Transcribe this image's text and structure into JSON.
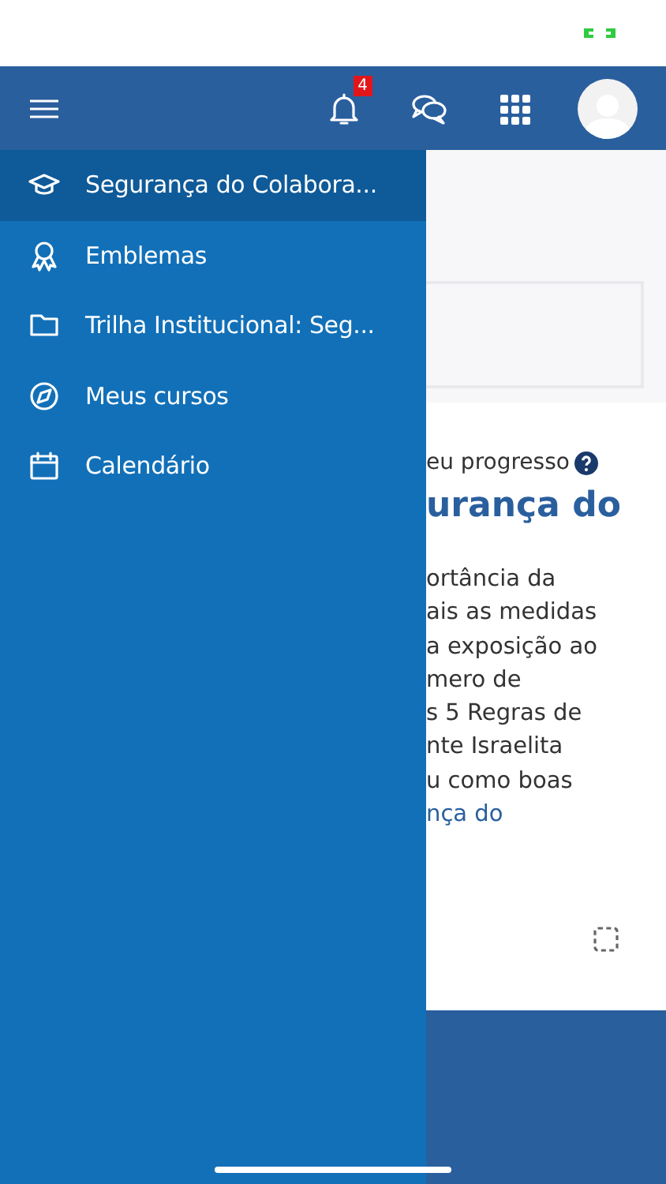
{
  "header": {
    "notification_count": "4"
  },
  "drawer": {
    "items": [
      {
        "label": "Segurança do Colabora...",
        "kind": "course",
        "selected": true
      },
      {
        "label": "Emblemas",
        "kind": "badges",
        "selected": false
      },
      {
        "label": "Trilha Institucional: Seg...",
        "kind": "category",
        "selected": false
      },
      {
        "label": "Meus cursos",
        "kind": "courses",
        "selected": false
      },
      {
        "label": "Calendário",
        "kind": "calendar",
        "selected": false
      }
    ]
  },
  "course_card": {
    "progress_label": "eu progresso",
    "title": "urança do",
    "description_lines": [
      "ortância da",
      "ais as medidas",
      "a exposição ao",
      "mero de",
      "s 5 Regras de",
      "nte Israelita",
      "u como boas"
    ],
    "link_text": "nça do"
  }
}
